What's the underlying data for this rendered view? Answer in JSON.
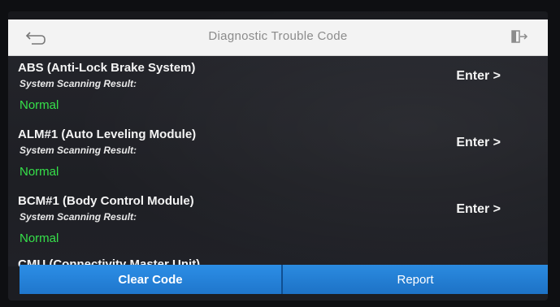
{
  "header": {
    "title": "Diagnostic Trouble Code",
    "back_icon": "back-arrow-icon",
    "exit_icon": "exit-icon"
  },
  "modules": [
    {
      "name": "ABS (Anti-Lock Brake System)",
      "subtitle": "System Scanning Result:",
      "status": "Normal",
      "action": "Enter >"
    },
    {
      "name": "ALM#1 (Auto Leveling Module)",
      "subtitle": "System Scanning Result:",
      "status": "Normal",
      "action": "Enter >"
    },
    {
      "name": "BCM#1 (Body Control Module)",
      "subtitle": "System Scanning Result:",
      "status": "Normal",
      "action": "Enter >"
    },
    {
      "name": "CMU (Connectivity Master Unit)"
    }
  ],
  "footer": {
    "clear_label": "Clear Code",
    "report_label": "Report"
  },
  "colors": {
    "status_normal": "#36e04a",
    "button_blue": "#2389de",
    "header_bg": "#f3f3f3"
  }
}
